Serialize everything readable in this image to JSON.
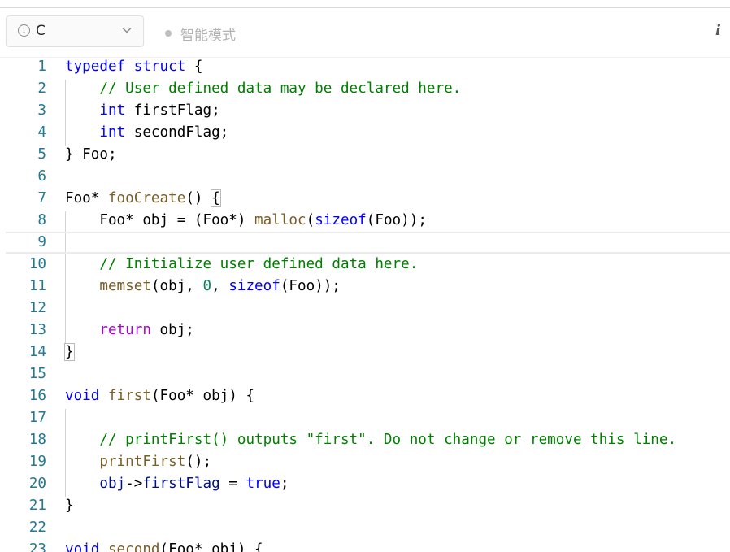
{
  "toolbar": {
    "language": "C",
    "mode_label": "智能模式",
    "info_icon": "info-circle-icon",
    "chevron_icon": "chevron-down-icon",
    "right_icon": "italic-info-icon"
  },
  "editor": {
    "current_line": 9,
    "lines": [
      [
        {
          "t": "typedef",
          "c": "kw"
        },
        {
          "t": " "
        },
        {
          "t": "struct",
          "c": "kw"
        },
        {
          "t": " {"
        }
      ],
      [
        {
          "t": "    "
        },
        {
          "t": "// User defined data may be declared here.",
          "c": "cm"
        }
      ],
      [
        {
          "t": "    "
        },
        {
          "t": "int",
          "c": "ty"
        },
        {
          "t": " firstFlag;"
        }
      ],
      [
        {
          "t": "    "
        },
        {
          "t": "int",
          "c": "ty"
        },
        {
          "t": " secondFlag;"
        }
      ],
      [
        {
          "t": "} Foo;"
        }
      ],
      [],
      [
        {
          "t": "Foo* "
        },
        {
          "t": "fooCreate",
          "c": "fn"
        },
        {
          "t": "() "
        },
        {
          "t": "{",
          "c": "bracket"
        }
      ],
      [
        {
          "t": "    Foo* obj = (Foo*) "
        },
        {
          "t": "malloc",
          "c": "fn"
        },
        {
          "t": "("
        },
        {
          "t": "sizeof",
          "c": "kw"
        },
        {
          "t": "(Foo));"
        }
      ],
      [],
      [
        {
          "t": "    "
        },
        {
          "t": "// Initialize user defined data here.",
          "c": "cm"
        }
      ],
      [
        {
          "t": "    "
        },
        {
          "t": "memset",
          "c": "fn"
        },
        {
          "t": "(obj, "
        },
        {
          "t": "0",
          "c": "nm"
        },
        {
          "t": ", "
        },
        {
          "t": "sizeof",
          "c": "kw"
        },
        {
          "t": "(Foo));"
        }
      ],
      [],
      [
        {
          "t": "    "
        },
        {
          "t": "return",
          "c": "ctl"
        },
        {
          "t": " obj;"
        }
      ],
      [
        {
          "t": "}",
          "c": "bracket"
        }
      ],
      [],
      [
        {
          "t": "void",
          "c": "kw"
        },
        {
          "t": " "
        },
        {
          "t": "first",
          "c": "fn"
        },
        {
          "t": "(Foo* obj) {"
        }
      ],
      [],
      [
        {
          "t": "    "
        },
        {
          "t": "// printFirst() outputs \"first\". Do not change or remove this line.",
          "c": "cm"
        }
      ],
      [
        {
          "t": "    "
        },
        {
          "t": "printFirst",
          "c": "fn"
        },
        {
          "t": "();"
        }
      ],
      [
        {
          "t": "    "
        },
        {
          "t": "obj",
          "c": "var"
        },
        {
          "t": "->"
        },
        {
          "t": "firstFlag",
          "c": "var"
        },
        {
          "t": " = "
        },
        {
          "t": "true",
          "c": "kw"
        },
        {
          "t": ";"
        }
      ],
      [
        {
          "t": "}"
        }
      ],
      [],
      [
        {
          "t": "void",
          "c": "kw"
        },
        {
          "t": " "
        },
        {
          "t": "second",
          "c": "fn"
        },
        {
          "t": "(Foo* obj) {"
        }
      ]
    ]
  }
}
